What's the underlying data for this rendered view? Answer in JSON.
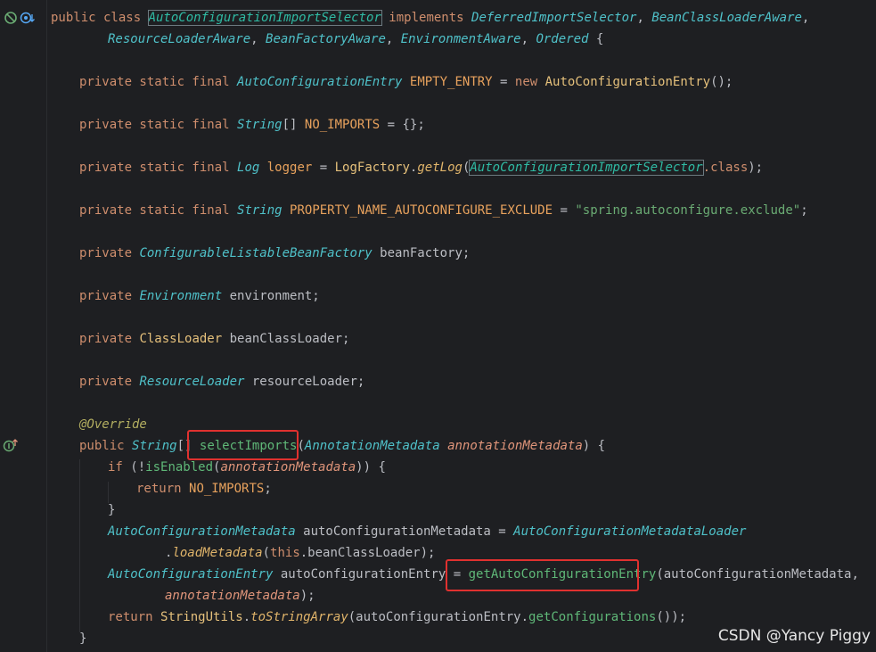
{
  "gutter": {
    "icons": [
      "no-entry-icon",
      "implements-icon",
      "override-icon"
    ]
  },
  "lines": [
    {
      "id": "l1",
      "tokens": [
        [
          "kw",
          "public class "
        ],
        [
          "cls boxed",
          "AutoConfigurationImportSelector"
        ],
        [
          "kw",
          " implements "
        ],
        [
          "cyan",
          "DeferredImportSelector"
        ],
        [
          "plain",
          ", "
        ],
        [
          "cyan",
          "BeanClassLoaderAware"
        ],
        [
          "plain",
          ","
        ]
      ]
    },
    {
      "id": "l2",
      "tokens": [
        [
          "cyan",
          "ResourceLoaderAware"
        ],
        [
          "plain",
          ", "
        ],
        [
          "cyan",
          "BeanFactoryAware"
        ],
        [
          "plain",
          ", "
        ],
        [
          "cyan",
          "EnvironmentAware"
        ],
        [
          "plain",
          ", "
        ],
        [
          "cyan",
          "Ordered"
        ],
        [
          "plain",
          " {"
        ]
      ]
    },
    {
      "id": "l3",
      "tokens": [
        [
          "kw",
          "private static final "
        ],
        [
          "cyan",
          "AutoConfigurationEntry"
        ],
        [
          "plain",
          " "
        ],
        [
          "pconst",
          "EMPTY_ENTRY"
        ],
        [
          "plain",
          " = "
        ],
        [
          "kw",
          "new "
        ],
        [
          "yel",
          "AutoConfigurationEntry"
        ],
        [
          "plain",
          "();"
        ]
      ]
    },
    {
      "id": "l4",
      "tokens": [
        [
          "kw",
          "private static final "
        ],
        [
          "cyan",
          "String"
        ],
        [
          "plain",
          "[] "
        ],
        [
          "pconst",
          "NO_IMPORTS"
        ],
        [
          "plain",
          " = {};"
        ]
      ]
    },
    {
      "id": "l5",
      "tokens": [
        [
          "kw",
          "private static final "
        ],
        [
          "cyan",
          "Log"
        ],
        [
          "plain",
          " "
        ],
        [
          "pconst",
          "logger"
        ],
        [
          "plain",
          " = "
        ],
        [
          "yel",
          "LogFactory"
        ],
        [
          "plain",
          "."
        ],
        [
          "staticfn",
          "getLog"
        ],
        [
          "plain",
          "("
        ],
        [
          "cls boxed",
          "AutoConfigurationImportSelector"
        ],
        [
          "kw",
          ".class"
        ],
        [
          "plain",
          ");"
        ]
      ]
    },
    {
      "id": "l6",
      "tokens": [
        [
          "kw",
          "private static final "
        ],
        [
          "cyan",
          "String"
        ],
        [
          "plain",
          " "
        ],
        [
          "pconst",
          "PROPERTY_NAME_AUTOCONFIGURE_EXCLUDE"
        ],
        [
          "plain",
          " = "
        ],
        [
          "str",
          "\"spring.autoconfigure.exclude\""
        ],
        [
          "plain",
          ";"
        ]
      ]
    },
    {
      "id": "l7",
      "tokens": [
        [
          "kw",
          "private "
        ],
        [
          "cyan",
          "ConfigurableListableBeanFactory"
        ],
        [
          "plain",
          " beanFactory;"
        ]
      ]
    },
    {
      "id": "l8",
      "tokens": [
        [
          "kw",
          "private "
        ],
        [
          "cyan",
          "Environment"
        ],
        [
          "plain",
          " environment;"
        ]
      ]
    },
    {
      "id": "l9",
      "tokens": [
        [
          "kw",
          "private "
        ],
        [
          "yel",
          "ClassLoader"
        ],
        [
          "plain",
          " beanClassLoader;"
        ]
      ]
    },
    {
      "id": "l10",
      "tokens": [
        [
          "kw",
          "private "
        ],
        [
          "cyan",
          "ResourceLoader"
        ],
        [
          "plain",
          " resourceLoader;"
        ]
      ]
    },
    {
      "id": "l11",
      "tokens": [
        [
          "ann",
          "@Override"
        ]
      ]
    },
    {
      "id": "l12",
      "tokens": [
        [
          "kw",
          "public "
        ],
        [
          "cyan",
          "String"
        ],
        [
          "plain",
          "[] "
        ],
        [
          "green",
          "selectImports"
        ],
        [
          "plain",
          "("
        ],
        [
          "cyan",
          "AnnotationMetadata"
        ],
        [
          "plain",
          " "
        ],
        [
          "param",
          "annotationMetadata"
        ],
        [
          "plain",
          ") {"
        ]
      ]
    },
    {
      "id": "l13",
      "tokens": [
        [
          "kw",
          "if "
        ],
        [
          "plain",
          "(!"
        ],
        [
          "green",
          "isEnabled"
        ],
        [
          "plain",
          "("
        ],
        [
          "param",
          "annotationMetadata"
        ],
        [
          "plain",
          ")) {"
        ]
      ]
    },
    {
      "id": "l14",
      "tokens": [
        [
          "kw",
          "return "
        ],
        [
          "pconst",
          "NO_IMPORTS"
        ],
        [
          "plain",
          ";"
        ]
      ]
    },
    {
      "id": "l15",
      "tokens": [
        [
          "plain",
          "}"
        ]
      ]
    },
    {
      "id": "l16",
      "tokens": [
        [
          "cyan",
          "AutoConfigurationMetadata"
        ],
        [
          "plain",
          " autoConfigurationMetadata = "
        ],
        [
          "cyan",
          "AutoConfigurationMetadataLoader"
        ]
      ]
    },
    {
      "id": "l17",
      "tokens": [
        [
          "plain",
          "."
        ],
        [
          "staticfn",
          "loadMetadata"
        ],
        [
          "plain",
          "("
        ],
        [
          "kw",
          "this"
        ],
        [
          "plain",
          ".beanClassLoader);"
        ]
      ]
    },
    {
      "id": "l18",
      "tokens": [
        [
          "cyan",
          "AutoConfigurationEntry"
        ],
        [
          "plain",
          " autoConfigurationEntry = "
        ],
        [
          "green",
          "getAutoConfigurationEntry"
        ],
        [
          "plain",
          "(autoConfigurationMetadata,"
        ]
      ]
    },
    {
      "id": "l19",
      "tokens": [
        [
          "param",
          "annotationMetadata"
        ],
        [
          "plain",
          ");"
        ]
      ]
    },
    {
      "id": "l20",
      "tokens": [
        [
          "kw",
          "return "
        ],
        [
          "yel",
          "StringUtils"
        ],
        [
          "plain",
          "."
        ],
        [
          "staticfn",
          "toStringArray"
        ],
        [
          "plain",
          "(autoConfigurationEntry."
        ],
        [
          "green",
          "getConfigurations"
        ],
        [
          "plain",
          "());"
        ]
      ]
    },
    {
      "id": "l21",
      "tokens": [
        [
          "plain",
          "}"
        ]
      ]
    }
  ],
  "watermark": "CSDN @Yancy Piggy"
}
